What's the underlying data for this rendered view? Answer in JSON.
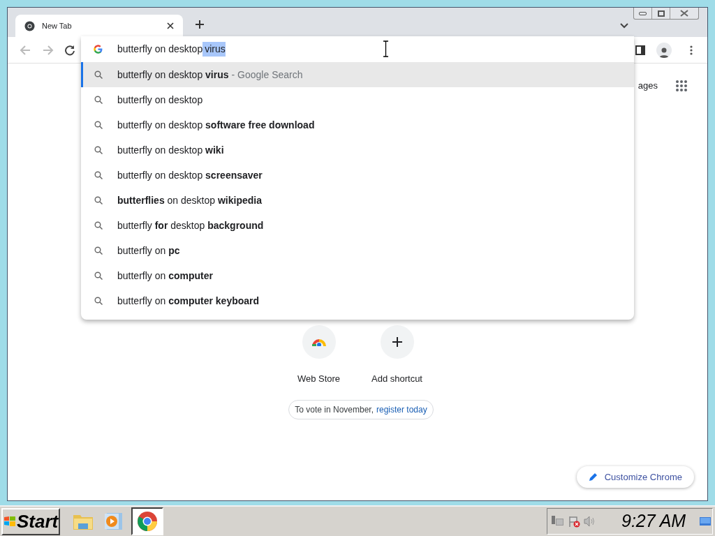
{
  "tabs": [
    {
      "title": "New Tab",
      "selected": true
    }
  ],
  "omnibox": {
    "text": "butterfly on desktop",
    "selected_text": "virus"
  },
  "suggestions": [
    {
      "text": "butterfly on desktop **virus**",
      "suffix": "- Google Search",
      "selected": true
    },
    {
      "text": "butterfly on desktop",
      "selected": false
    },
    {
      "text": "butterfly on desktop **software free download**",
      "selected": false
    },
    {
      "text": "butterfly on desktop **wiki**",
      "selected": false
    },
    {
      "text": "butterfly on desktop **screensaver**",
      "selected": false
    },
    {
      "text": "**butterflies** on desktop **wikipedia**",
      "selected": false
    },
    {
      "text": "butterfly **for** desktop **background**",
      "selected": false
    },
    {
      "text": "butterfly on **pc**",
      "selected": false
    },
    {
      "text": "butterfly on **computer**",
      "selected": false
    },
    {
      "text": "butterfly on **computer keyboard**",
      "selected": false
    }
  ],
  "page": {
    "header_link": "ages",
    "shortcuts": [
      {
        "kind": "webstore",
        "label": "Web Store"
      },
      {
        "kind": "add",
        "label": "Add shortcut"
      }
    ],
    "promo": {
      "text": "To vote in November,",
      "link": "register today"
    },
    "customize": "Customize Chrome"
  },
  "taskbar": {
    "start": "Start",
    "apps": [
      {
        "kind": "folder",
        "selected": false
      },
      {
        "kind": "media",
        "selected": false
      },
      {
        "kind": "chrome",
        "selected": true
      }
    ],
    "clock": "9:27 AM"
  }
}
